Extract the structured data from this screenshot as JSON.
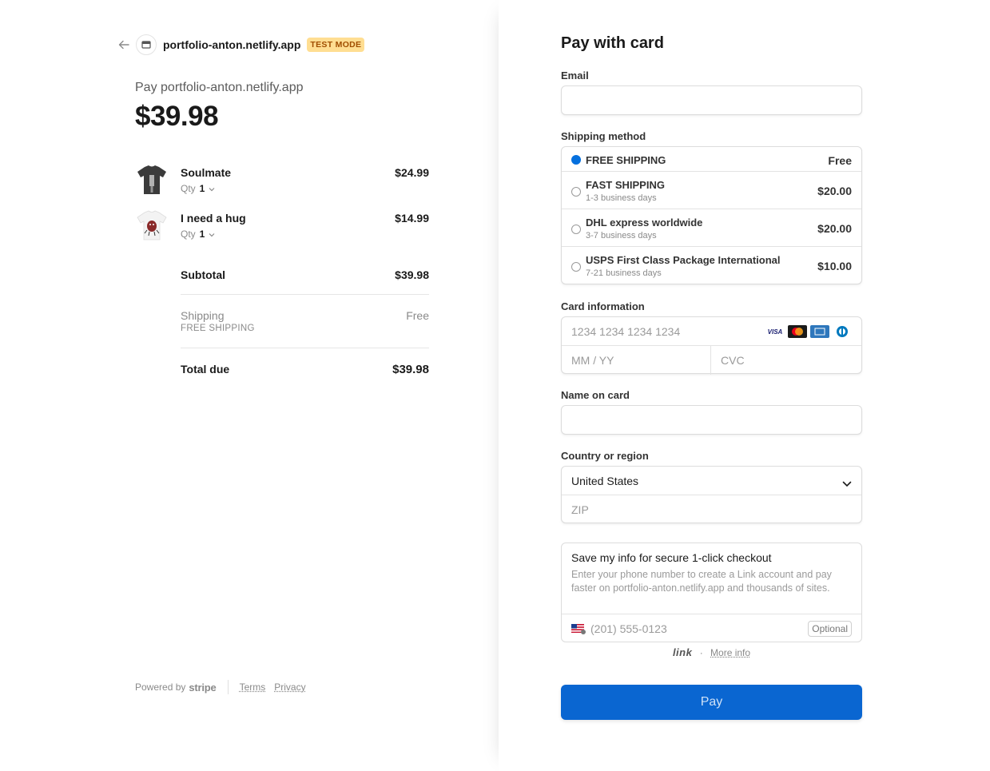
{
  "header": {
    "merchant": "portfolio-anton.netlify.app",
    "test_mode": "TEST MODE"
  },
  "summary": {
    "pay_label": "Pay portfolio-anton.netlify.app",
    "amount": "$39.98",
    "items": [
      {
        "name": "Soulmate",
        "qty_label": "Qty",
        "qty": "1",
        "price": "$24.99"
      },
      {
        "name": "I need a hug",
        "qty_label": "Qty",
        "qty": "1",
        "price": "$14.99"
      }
    ],
    "subtotal_label": "Subtotal",
    "subtotal": "$39.98",
    "shipping_label": "Shipping",
    "shipping_method": "FREE SHIPPING",
    "shipping_value": "Free",
    "total_label": "Total due",
    "total": "$39.98"
  },
  "footer": {
    "powered_by": "Powered by",
    "brand": "stripe",
    "terms": "Terms",
    "privacy": "Privacy"
  },
  "form": {
    "title": "Pay with card",
    "email_label": "Email",
    "email_value": "",
    "shipping_label": "Shipping method",
    "shipping_options": [
      {
        "name": "FREE SHIPPING",
        "desc": "",
        "price": "Free",
        "selected": true
      },
      {
        "name": "FAST SHIPPING",
        "desc": "1-3 business days",
        "price": "$20.00",
        "selected": false
      },
      {
        "name": "DHL express worldwide",
        "desc": "3-7 business days",
        "price": "$20.00",
        "selected": false
      },
      {
        "name": "USPS First Class Package International",
        "desc": "7-21 business days",
        "price": "$10.00",
        "selected": false
      }
    ],
    "card_label": "Card information",
    "card_number_placeholder": "1234 1234 1234 1234",
    "expiry_placeholder": "MM / YY",
    "cvc_placeholder": "CVC",
    "card_brands": [
      "VISA",
      "mastercard",
      "amex",
      "diners"
    ],
    "name_label": "Name on card",
    "name_value": "",
    "country_label": "Country or region",
    "country_value": "United States",
    "zip_placeholder": "ZIP",
    "save_title": "Save my info for secure 1-click checkout",
    "save_desc": "Enter your phone number to create a Link account and pay faster on portfolio-anton.netlify.app and thousands of sites.",
    "phone_placeholder": "(201) 555-0123",
    "optional": "Optional",
    "link_brand": "link",
    "link_sep": "·",
    "more_info": "More info",
    "pay_button": "Pay"
  },
  "colors": {
    "accent": "#0a66d1",
    "test_badge_bg": "#ffde92",
    "test_badge_text": "#a04e00"
  }
}
